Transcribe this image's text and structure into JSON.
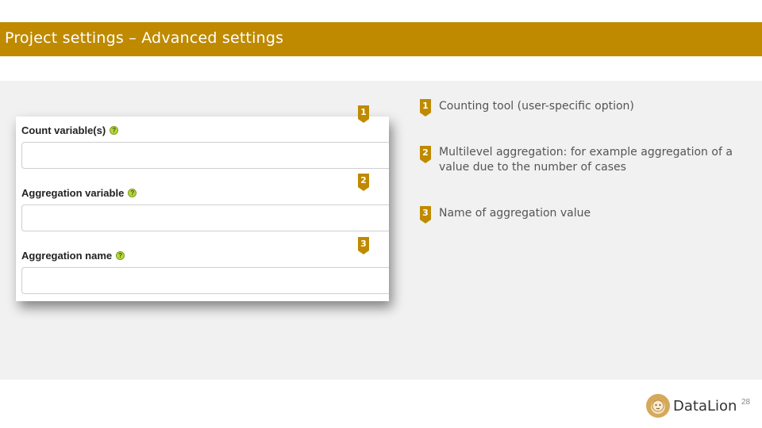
{
  "slide": {
    "title": "Project settings – Advanced settings",
    "page_number": "28"
  },
  "form": {
    "fields": [
      {
        "label": "Count variable(s)",
        "value": ""
      },
      {
        "label": "Aggregation variable",
        "value": ""
      },
      {
        "label": "Aggregation name",
        "value": ""
      }
    ],
    "help_icon": "help-icon"
  },
  "markers": [
    "1",
    "2",
    "3"
  ],
  "descriptions": [
    {
      "number": "1",
      "text": "Counting tool (user-specific option)"
    },
    {
      "number": "2",
      "text": "Multilevel aggregation: for example aggregation of a value due to the number of cases"
    },
    {
      "number": "3",
      "text": "Name of aggregation value"
    }
  ],
  "logo": {
    "text": "DataLion",
    "icon": "lion-icon"
  },
  "colors": {
    "accent": "#bf8a00",
    "band": "#f1f1f1",
    "help": "#b8d83a"
  }
}
